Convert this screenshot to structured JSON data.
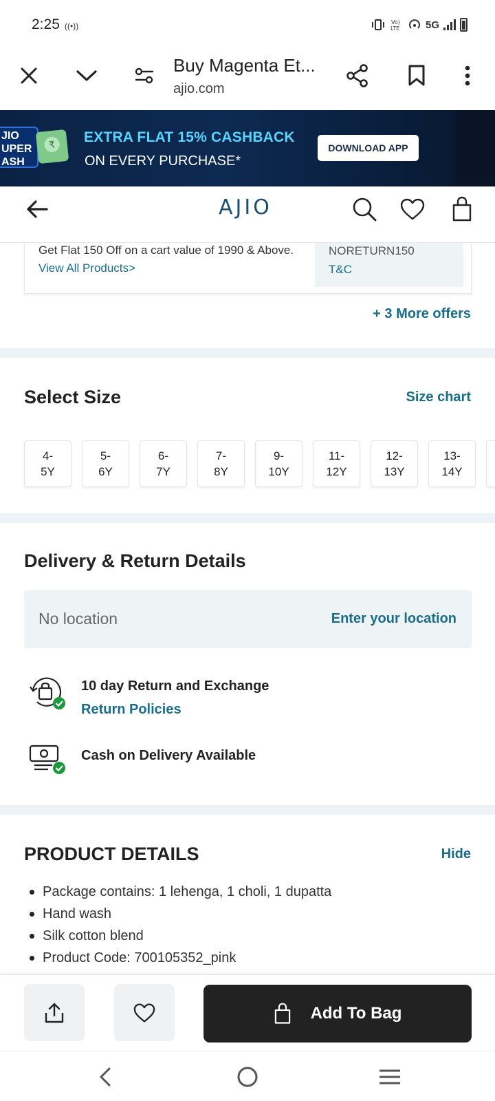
{
  "status_bar": {
    "time": "2:25",
    "hotspot_symbol": "((•))",
    "network": "5G",
    "icons": [
      "vibrate-icon",
      "volte-icon",
      "hotspot-icon",
      "signal-icon",
      "battery-icon"
    ]
  },
  "browser": {
    "page_title": "Buy Magenta Et...",
    "url": "ajio.com",
    "icons": [
      "close-icon",
      "chevron-down-icon",
      "site-settings-icon",
      "share-icon",
      "bookmark-icon",
      "more-icon"
    ]
  },
  "promo": {
    "logo_text": "AJIO SUPER CASH",
    "headline": "EXTRA FLAT 15% CASHBACK",
    "subline": "ON EVERY PURCHASE*",
    "button": "DOWNLOAD APP",
    "colors": {
      "headline": "#5ad4ff",
      "background": "#0b2244"
    }
  },
  "header": {
    "logo": "AJIO",
    "icons": [
      "back-arrow-icon",
      "search-icon",
      "heart-icon",
      "bag-icon"
    ]
  },
  "offer": {
    "text": "Get Flat 150 Off on a cart value of 1990 & Above.",
    "link": "View All Products>",
    "code": "NORETURN150",
    "terms": "T&C",
    "more_offers": "+ 3 More offers"
  },
  "size_section": {
    "title": "Select Size",
    "size_chart": "Size chart",
    "sizes": [
      {
        "line1": "4-",
        "line2": "5Y"
      },
      {
        "line1": "5-",
        "line2": "6Y"
      },
      {
        "line1": "6-",
        "line2": "7Y"
      },
      {
        "line1": "7-",
        "line2": "8Y"
      },
      {
        "line1": "9-",
        "line2": "10Y"
      },
      {
        "line1": "11-",
        "line2": "12Y"
      },
      {
        "line1": "12-",
        "line2": "13Y"
      },
      {
        "line1": "13-",
        "line2": "14Y"
      }
    ]
  },
  "delivery": {
    "title": "Delivery & Return Details",
    "location_placeholder": "No location",
    "enter_location": "Enter your location",
    "return_exchange": "10 day Return and Exchange",
    "return_policies": "Return Policies",
    "cod": "Cash on Delivery Available"
  },
  "product_details": {
    "title": "PRODUCT DETAILS",
    "hide": "Hide",
    "items": [
      "Package contains: 1 lehenga, 1 choli, 1 dupatta",
      "Hand wash",
      "Silk cotton blend",
      "Product Code: 700105352_pink"
    ]
  },
  "actions": {
    "add_to_bag": "Add To Bag",
    "icons": [
      "share-upload-icon",
      "wishlist-heart-icon",
      "bag-icon"
    ]
  },
  "nav": {
    "icons": [
      "nav-back-icon",
      "nav-home-icon",
      "nav-recents-icon"
    ]
  },
  "accent_color": "#176d8a"
}
